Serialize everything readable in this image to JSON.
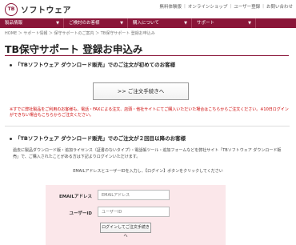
{
  "header": {
    "logo_text": "ソフトウェア",
    "links": [
      "無料体験版",
      "オンラインショップ",
      "ユーザー登録",
      "お問い合わせ"
    ]
  },
  "nav": {
    "items": [
      {
        "label": "製品情報"
      },
      {
        "label": "ご検討のお客様"
      },
      {
        "label": "購入について"
      },
      {
        "label": "サポート"
      }
    ]
  },
  "breadcrumb": "HOME ＞ サポート情報 ＞ 保守サポートのご案内 ＞ TB保守サポート 登録お申込み",
  "page_title": "TB保守サポート 登録お申込み",
  "section1": {
    "heading": "「TBソフトウェア ダウンロード販売」でのご注文が初めてのお客様",
    "button_label": ">> ご注文手続きへ",
    "note": "※すでに弊社製品をご利用のお客様も、電話・FAXによる注文、店頭・他社サイトにてご購入いただいた場合はこちらからご注文ください。※10日ログインができない場合もこちらからご注文ください。"
  },
  "section2": {
    "heading": "「TBソフトウェア ダウンロード販売」でのご注文が２回目以降のお客様",
    "description": "過去に製品ダウンロード版・追加ライセンス（証書のないタイプ）・電話帳ツール・追加フォームなどを弊社サイト「TBソフトウェア ダウンロード販売」で、ご購入されたことがある方は下記よりログインいただけます。",
    "instruction": "EMAILアドレスとユーザーIDを入力し、【ログイン】ボタンをクリックしてください",
    "email_label": "EMAILアドレス",
    "email_placeholder": "EMAILアドレス",
    "userid_label": "ユーザーID",
    "userid_placeholder": "ユーザーID",
    "login_button": "ログインしてご注文手続きへ"
  }
}
